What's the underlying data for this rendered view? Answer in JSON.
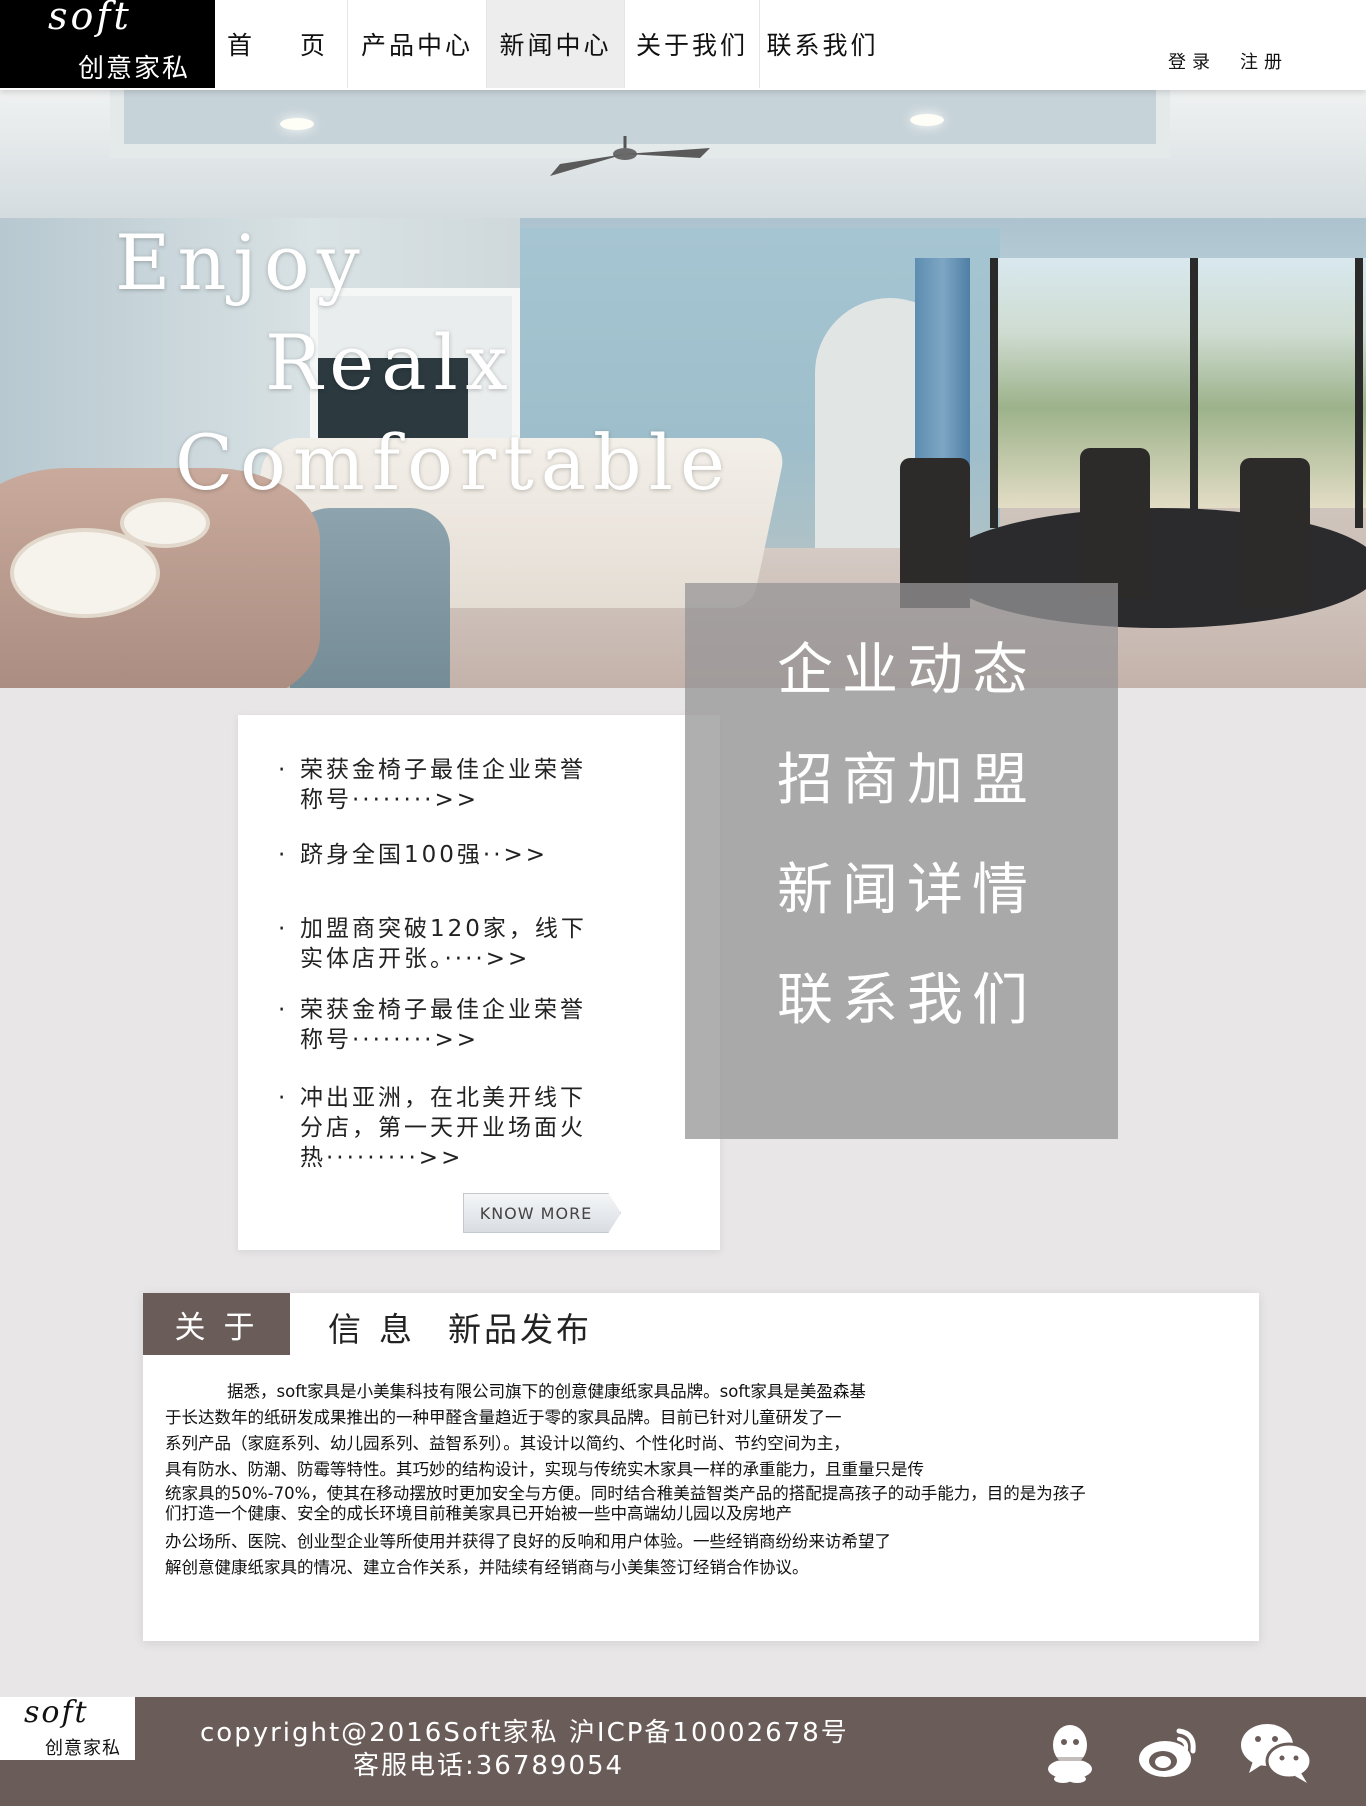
{
  "brand": {
    "logo_en": "soft",
    "logo_cn": "创意家私"
  },
  "nav": {
    "items": [
      {
        "label": "首 页",
        "active": false
      },
      {
        "label": "产品中心",
        "active": false
      },
      {
        "label": "新闻中心",
        "active": true
      },
      {
        "label": "关于我们",
        "active": false
      },
      {
        "label": "联系我们",
        "active": false
      }
    ],
    "login": "登录",
    "register": "注册"
  },
  "hero": {
    "line1": "Enjoy",
    "line2": "Realx",
    "line3": "Comfortable"
  },
  "news": {
    "bullet": "·",
    "items": [
      "荣获金椅子最佳企业荣誉称号········>>",
      "跻身全国100强··>>",
      "加盟商突破120家，线下实体店开张。····>>",
      "荣获金椅子最佳企业荣誉称号········>>",
      "冲出亚洲，在北美开线下分店，第一天开业场面火热·········>>"
    ],
    "know_more": "KNOW MORE"
  },
  "side_menu": {
    "items": [
      "企业动态",
      "招商加盟",
      "新闻详情",
      "联系我们"
    ]
  },
  "about": {
    "tab": "关于",
    "sub1": "信息",
    "sub2": "新品发布",
    "lines": [
      "据悉，soft家具是小美集科技有限公司旗下的创意健康纸家具品牌。soft家具是美盈森基",
      "于长达数年的纸研发成果推出的一种甲醛含量趋近于零的家具品牌。目前已针对儿童研发了一",
      "系列产品（家庭系列、幼儿园系列、益智系列）。其设计以简约、个性化时尚、节约空间为主，",
      "具有防水、防潮、防霉等特性。其巧妙的结构设计，实现与传统实木家具一样的承重能力，且重量只是传",
      "统家具的50%-70%，使其在移动摆放时更加安全与方便。同时结合稚美益智类产品的搭配提高孩子的动手能力，目的是为孩子",
      "们打造一个健康、安全的成长环境目前稚美家具已开始被一些中高端幼儿园以及房地产",
      "办公场所、医院、创业型企业等所使用并获得了良好的反响和用户体验。一些经销商纷纷来访希望了",
      "解创意健康纸家具的情况、建立合作关系，并陆续有经销商与小美集签订经销合作协议。"
    ]
  },
  "footer": {
    "logo_en": "soft",
    "logo_cn": "创意家私",
    "copyright": "copyright@2016Soft家私 沪ICP备10002678号",
    "phone": "客服电话:36789054",
    "icons": [
      "qq-icon",
      "weibo-icon",
      "wechat-icon"
    ]
  }
}
